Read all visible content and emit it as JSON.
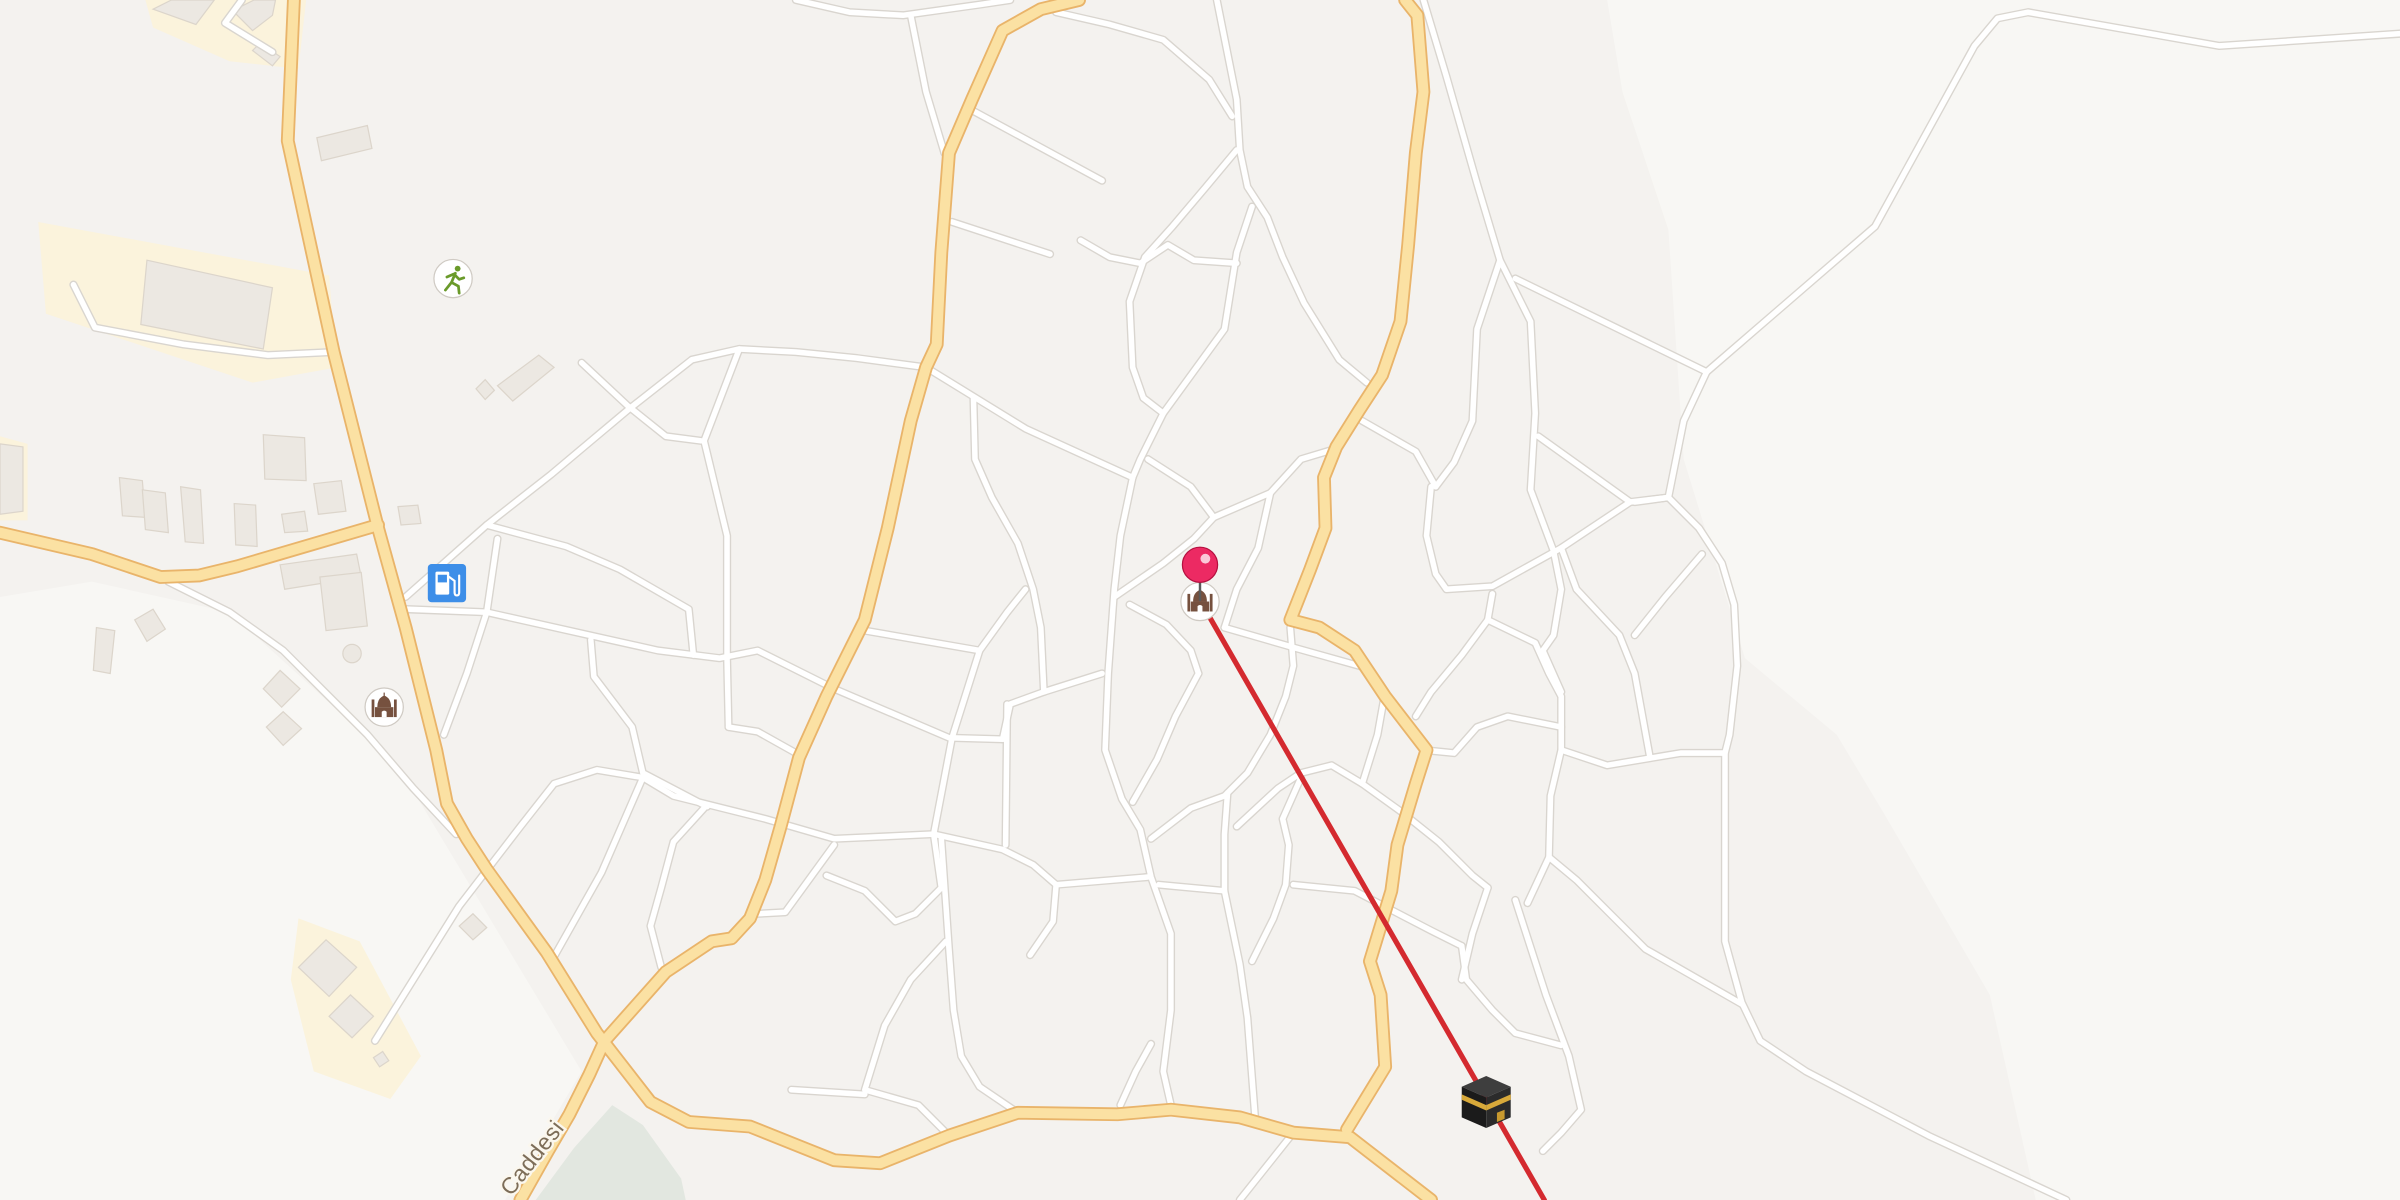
{
  "map": {
    "street_label": "Caddesi",
    "markers": {
      "selected_location": {
        "icon": "map-pin-icon",
        "color": "#ec2a63"
      },
      "mosque_center": {
        "icon": "mosque-icon"
      },
      "mosque_west": {
        "icon": "mosque-icon"
      },
      "fuel_station": {
        "icon": "fuel-pump-icon",
        "color": "#3d8ee8"
      },
      "sports_facility": {
        "icon": "running-figure-icon",
        "color": "#6a9a2a"
      },
      "qibla": {
        "icon": "kaaba-icon"
      }
    },
    "qibla_line": {
      "color": "#d42a2f"
    },
    "colors": {
      "land": "#f4f2ef",
      "land_light": "#f8f7f4",
      "landuse_yellow": "#fbf3dc",
      "park": "#e2e7e0",
      "building": "#ece8e2",
      "building_outline": "#dcd5cb",
      "major_road_fill": "#fbe1a3",
      "major_road_casing": "#e9b46a",
      "minor_road_fill": "#ffffff",
      "minor_road_casing": "#d9d5cf",
      "mosque_glyph": "#76513f"
    }
  }
}
